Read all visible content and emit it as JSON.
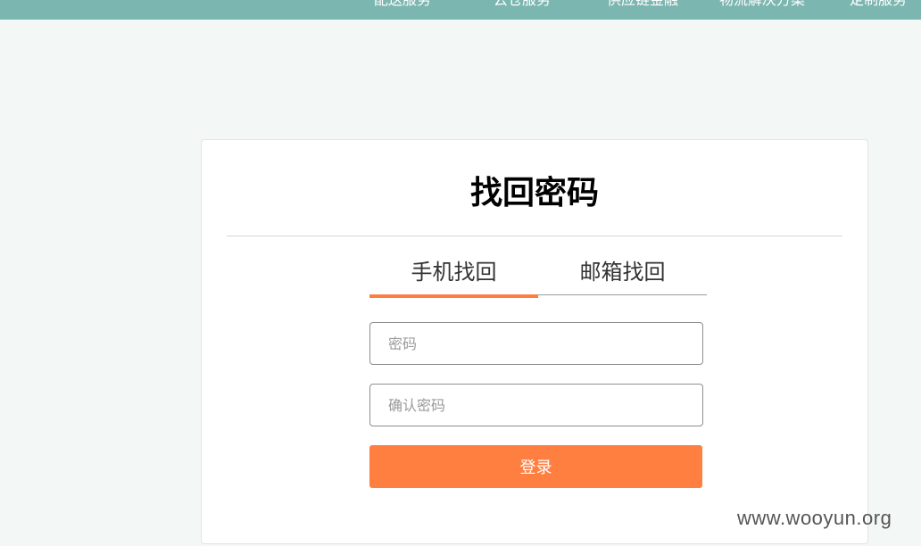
{
  "nav": {
    "items": [
      "配送服务",
      "云仓服务",
      "供应链金融",
      "物流解决方案",
      "定制服务"
    ]
  },
  "form": {
    "title": "找回密码",
    "tabs": [
      {
        "label": "手机找回",
        "active": true
      },
      {
        "label": "邮箱找回",
        "active": false
      }
    ],
    "password_placeholder": "密码",
    "confirm_placeholder": "确认密码",
    "submit_label": "登录"
  },
  "watermark": "www.wooyun.org",
  "colors": {
    "nav_bg": "#7cb6b0",
    "accent": "#ff7f40",
    "page_bg": "#f3f8f7"
  }
}
